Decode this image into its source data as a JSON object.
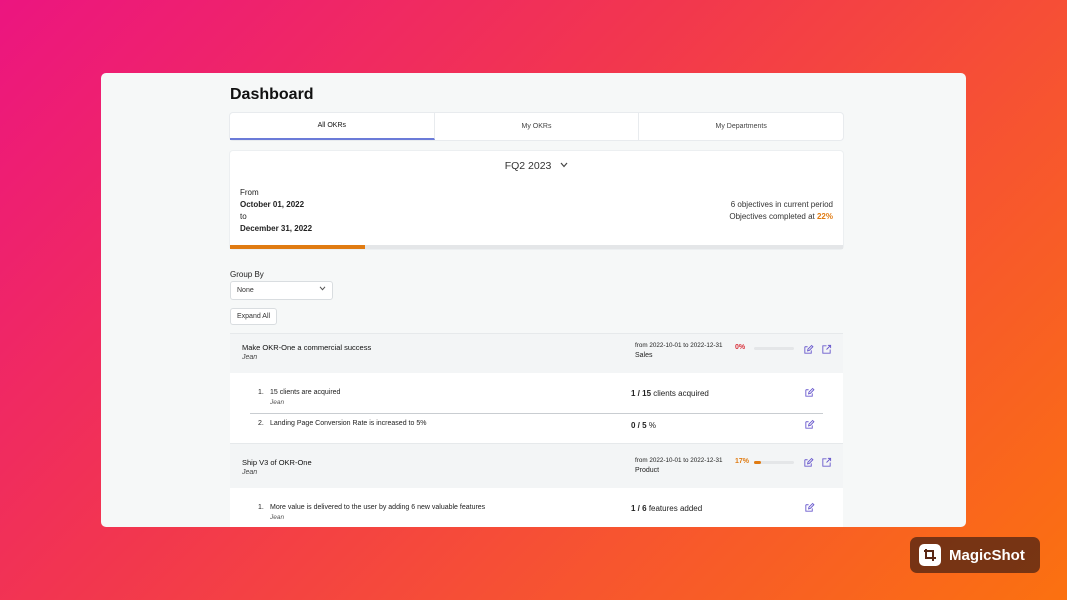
{
  "page": {
    "title": "Dashboard"
  },
  "tabs": [
    {
      "label": "All OKRs",
      "active": true
    },
    {
      "label": "My OKRs",
      "active": false
    },
    {
      "label": "My Departments",
      "active": false
    }
  ],
  "period": {
    "selected": "FQ2 2023",
    "from_label": "From",
    "from_date": "October 01, 2022",
    "to_label": "to",
    "to_date": "December 31, 2022",
    "objectives_text": "6 objectives in current period",
    "completed_text": "Objectives completed at",
    "completed_pct": "22%",
    "progress": 0.22
  },
  "group_by": {
    "label": "Group By",
    "selected": "None"
  },
  "expand_label": "Expand All",
  "objectives": [
    {
      "title": "Make OKR-One a commercial success",
      "owner": "Jean",
      "range": "from 2022-10-01 to 2022-12-31",
      "department": "Sales",
      "pct": "0%",
      "progress": 0,
      "key_results": [
        {
          "num": "1.",
          "title": "15 clients are acquired",
          "owner": "Jean",
          "current": "1 / 15",
          "unit": "clients acquired"
        },
        {
          "num": "2.",
          "title": "Landing Page Conversion Rate is increased to 5%",
          "owner": "",
          "current": "0 / 5",
          "unit": "%"
        }
      ]
    },
    {
      "title": "Ship V3 of OKR-One",
      "owner": "Jean",
      "range": "from 2022-10-01 to 2022-12-31",
      "department": "Product",
      "pct": "17%",
      "progress": 0.17,
      "key_results": [
        {
          "num": "1.",
          "title": "More value is delivered to the user by adding 6 new valuable features",
          "owner": "Jean",
          "current": "1 / 6",
          "unit": "features added"
        }
      ]
    }
  ],
  "colors": {
    "accent": "#e07b12",
    "danger": "#d9303a",
    "icon": "#6a5acd",
    "tab_active": "#6b7bd8"
  },
  "icons": {
    "edit": "pencil-square-icon",
    "open": "external-link-icon",
    "dropdown": "chevron-down-icon"
  },
  "brand": {
    "name": "MagicShot"
  }
}
